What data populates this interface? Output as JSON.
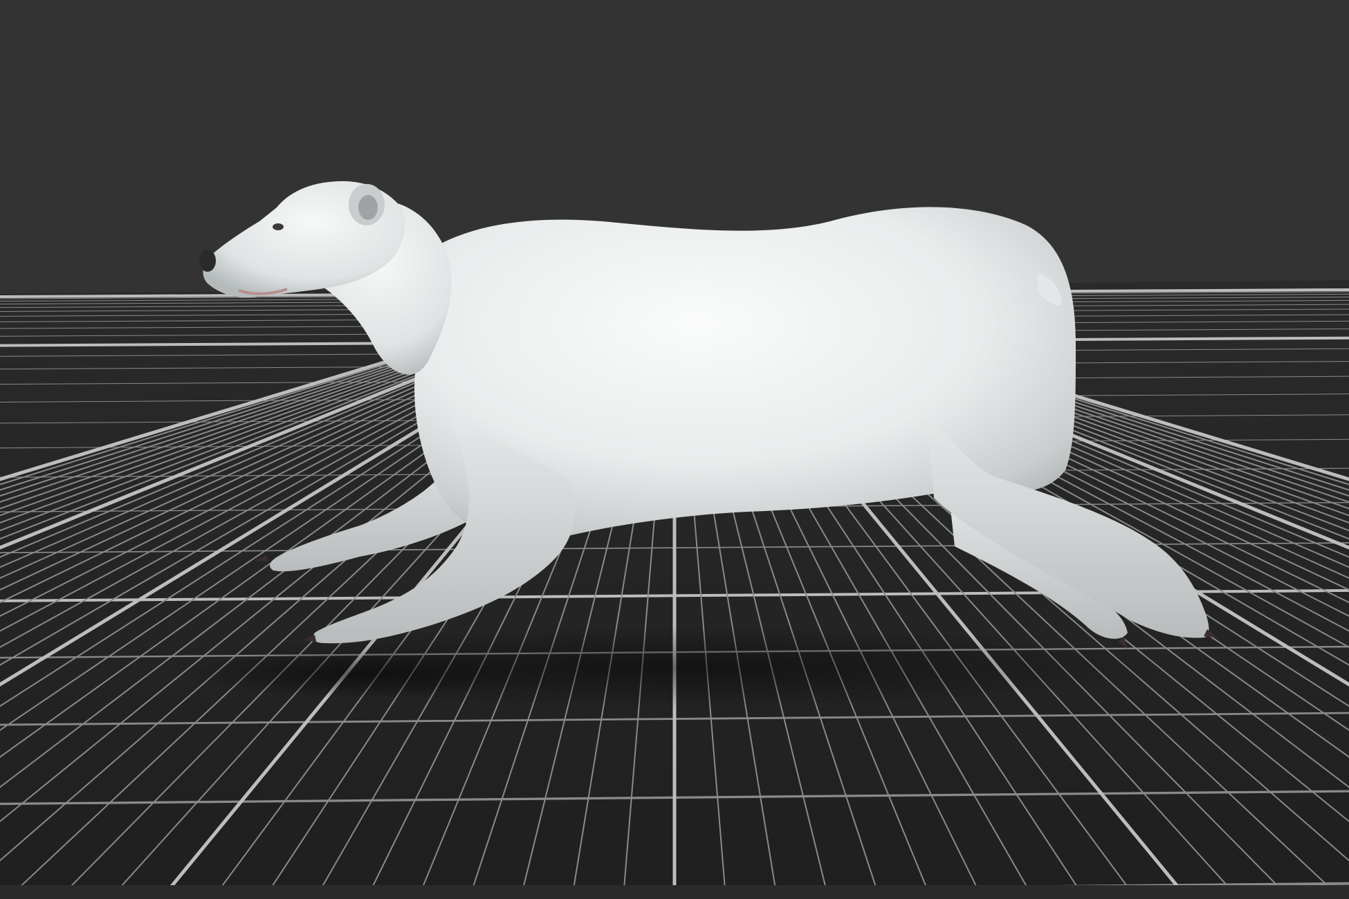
{
  "viewport": {
    "background_color": "#333333",
    "floor_color": "#262626",
    "grid_minor_color": "#8a8a8a",
    "grid_major_color": "#bdbdbd",
    "model_fur_color": "#f1f3f3",
    "model_shadow_color": "#1a1a1a"
  },
  "scene": {
    "model_name": "polar-bear",
    "pose": "running",
    "camera_view": "side-perspective",
    "grid_visible": true
  }
}
